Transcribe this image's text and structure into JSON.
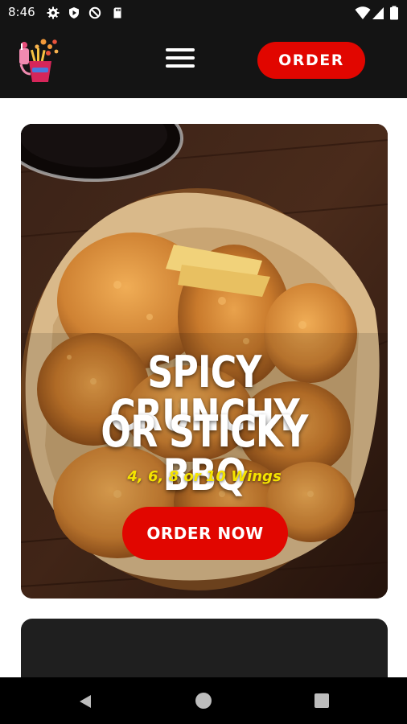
{
  "status_bar": {
    "time": "8:46",
    "left_icons": [
      "gear-icon",
      "play-protect-icon",
      "no-sync-icon",
      "sd-card-icon"
    ],
    "right_icons": [
      "wifi-icon",
      "cellular-signal-icon",
      "battery-icon"
    ]
  },
  "header": {
    "logo_icon": "food-logo-icon",
    "menu_icon": "hamburger-menu-icon",
    "order_label": "ORDER"
  },
  "hero": {
    "title_line1": "SPICY CRUNCHY",
    "title_line2": "OR STICKY BBQ",
    "subtitle": "4, 6, 8 or 10 Wings",
    "cta_label": "ORDER NOW"
  },
  "fab": {
    "icon": "share-icon"
  },
  "nav_bar": {
    "icons": [
      "back-icon",
      "home-icon",
      "recents-icon"
    ]
  },
  "colors": {
    "accent_red": "#e10600",
    "header_bg": "#141414",
    "subtitle_yellow": "#f5e400",
    "share_icon_red": "#e02020"
  }
}
